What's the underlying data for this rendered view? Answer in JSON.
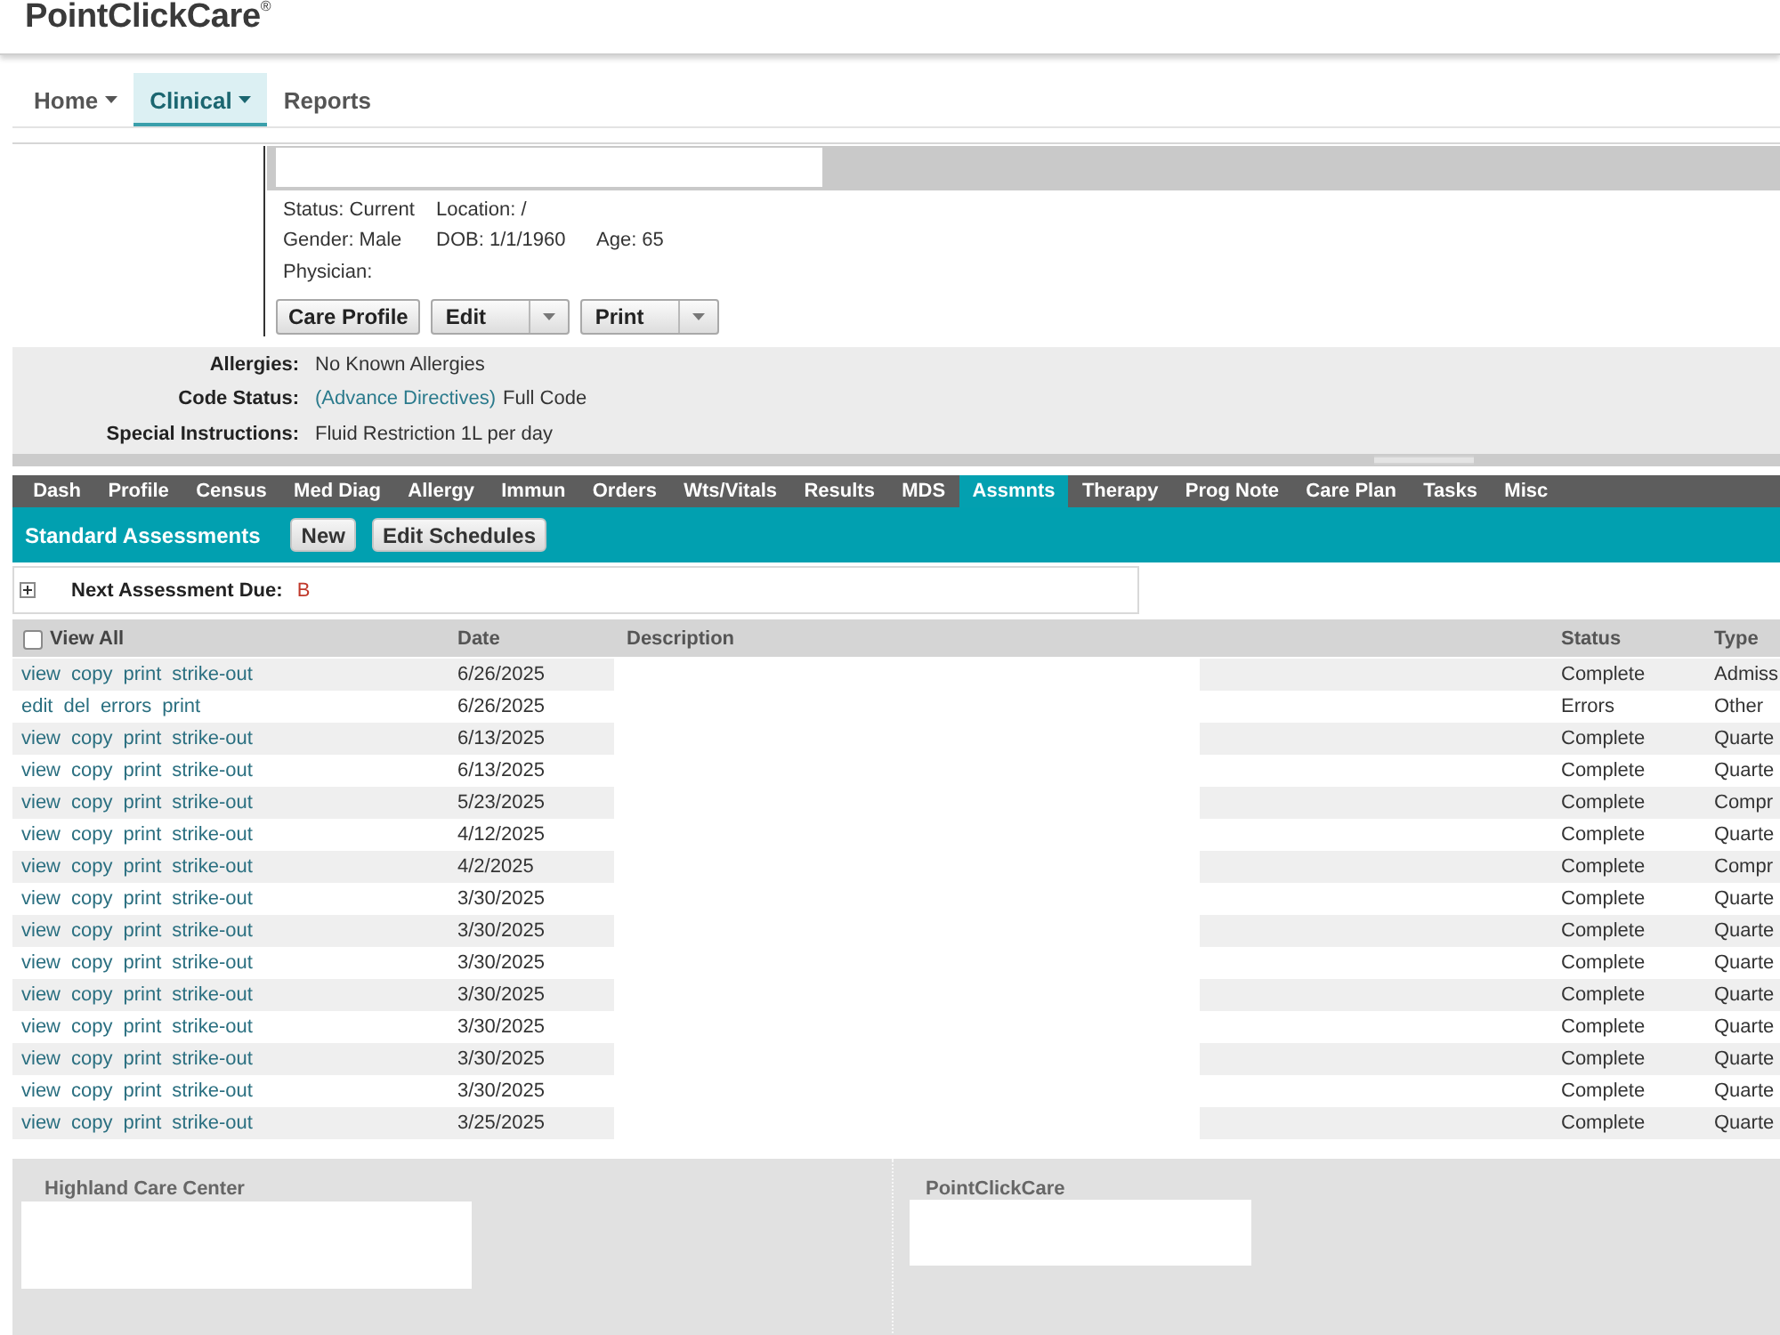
{
  "header": {
    "logo": "PointClickCare$^{®}$"
  },
  "nav": [
    {
      "label": "Home",
      "dropdown": true,
      "selected": false
    },
    {
      "label": "Clinical",
      "dropdown": true,
      "selected": true
    },
    {
      "label": "Reports",
      "dropdown": false,
      "selected": false
    }
  ],
  "patient": {
    "info_rows": [
      [
        "Status: Current",
        "Location: /"
      ],
      [
        "Gender: Male",
        "DOB: 1/1/1960",
        "Age: 65"
      ],
      [
        "Physician:"
      ]
    ],
    "buttons": [
      {
        "label": "Care Profile",
        "kind": "plain"
      },
      {
        "label": "Edit",
        "kind": "split"
      },
      {
        "label": "Print",
        "kind": "split"
      }
    ]
  },
  "summary": [
    {
      "label": "Allergies:",
      "value": "No Known Allergies"
    },
    {
      "label": "Code Status:",
      "link": "(Advance Directives)",
      "value": "Full Code"
    },
    {
      "label": "Special Instructions:",
      "value": "Fluid Restriction 1L per day"
    }
  ],
  "tabs": [
    {
      "label": "Dash",
      "selected": false
    },
    {
      "label": "Profile",
      "selected": false
    },
    {
      "label": "Census",
      "selected": false
    },
    {
      "label": "Med Diag",
      "selected": false
    },
    {
      "label": "Allergy",
      "selected": false
    },
    {
      "label": "Immun",
      "selected": false
    },
    {
      "label": "Orders",
      "selected": false
    },
    {
      "label": "Wts/Vitals",
      "selected": false
    },
    {
      "label": "Results",
      "selected": false
    },
    {
      "label": "MDS",
      "selected": false
    },
    {
      "label": "Assmnts",
      "selected": true
    },
    {
      "label": "Therapy",
      "selected": false
    },
    {
      "label": "Prog Note",
      "selected": false
    },
    {
      "label": "Care Plan",
      "selected": false
    },
    {
      "label": "Tasks",
      "selected": false
    },
    {
      "label": "Misc",
      "selected": false
    }
  ],
  "section": {
    "title": "Standard Assessments",
    "buttons": [
      "New",
      "Edit Schedules"
    ]
  },
  "next_due": {
    "expanded": false,
    "label": "Next Assessment Due:",
    "value": "B"
  },
  "table": {
    "select_all": {
      "label": "View All",
      "checked": false
    },
    "columns": [
      "Date",
      "Description",
      "Status",
      "Type"
    ],
    "rows": [
      {
        "actions": [
          "view",
          "copy",
          "print",
          "strike-out"
        ],
        "date": "6/26/2025",
        "status": "Complete",
        "type": "Admiss"
      },
      {
        "actions": [
          "edit",
          "del",
          "errors",
          "print"
        ],
        "date": "6/26/2025",
        "status": "Errors",
        "type": "Other"
      },
      {
        "actions": [
          "view",
          "copy",
          "print",
          "strike-out"
        ],
        "date": "6/13/2025",
        "status": "Complete",
        "type": "Quarte"
      },
      {
        "actions": [
          "view",
          "copy",
          "print",
          "strike-out"
        ],
        "date": "6/13/2025",
        "status": "Complete",
        "type": "Quarte"
      },
      {
        "actions": [
          "view",
          "copy",
          "print",
          "strike-out"
        ],
        "date": "5/23/2025",
        "status": "Complete",
        "type": "Compr"
      },
      {
        "actions": [
          "view",
          "copy",
          "print",
          "strike-out"
        ],
        "date": "4/12/2025",
        "status": "Complete",
        "type": "Quarte"
      },
      {
        "actions": [
          "view",
          "copy",
          "print",
          "strike-out"
        ],
        "date": "4/2/2025",
        "status": "Complete",
        "type": "Compr"
      },
      {
        "actions": [
          "view",
          "copy",
          "print",
          "strike-out"
        ],
        "date": "3/30/2025",
        "status": "Complete",
        "type": "Quarte"
      },
      {
        "actions": [
          "view",
          "copy",
          "print",
          "strike-out"
        ],
        "date": "3/30/2025",
        "status": "Complete",
        "type": "Quarte"
      },
      {
        "actions": [
          "view",
          "copy",
          "print",
          "strike-out"
        ],
        "date": "3/30/2025",
        "status": "Complete",
        "type": "Quarte"
      },
      {
        "actions": [
          "view",
          "copy",
          "print",
          "strike-out"
        ],
        "date": "3/30/2025",
        "status": "Complete",
        "type": "Quarte"
      },
      {
        "actions": [
          "view",
          "copy",
          "print",
          "strike-out"
        ],
        "date": "3/30/2025",
        "status": "Complete",
        "type": "Quarte"
      },
      {
        "actions": [
          "view",
          "copy",
          "print",
          "strike-out"
        ],
        "date": "3/30/2025",
        "status": "Complete",
        "type": "Quarte"
      },
      {
        "actions": [
          "view",
          "copy",
          "print",
          "strike-out"
        ],
        "date": "3/30/2025",
        "status": "Complete",
        "type": "Quarte"
      },
      {
        "actions": [
          "view",
          "copy",
          "print",
          "strike-out"
        ],
        "date": "3/25/2025",
        "status": "Complete",
        "type": "Quarte"
      }
    ]
  },
  "footer": [
    {
      "title": "Highland Care Center"
    },
    {
      "title": "PointClickCare"
    }
  ]
}
